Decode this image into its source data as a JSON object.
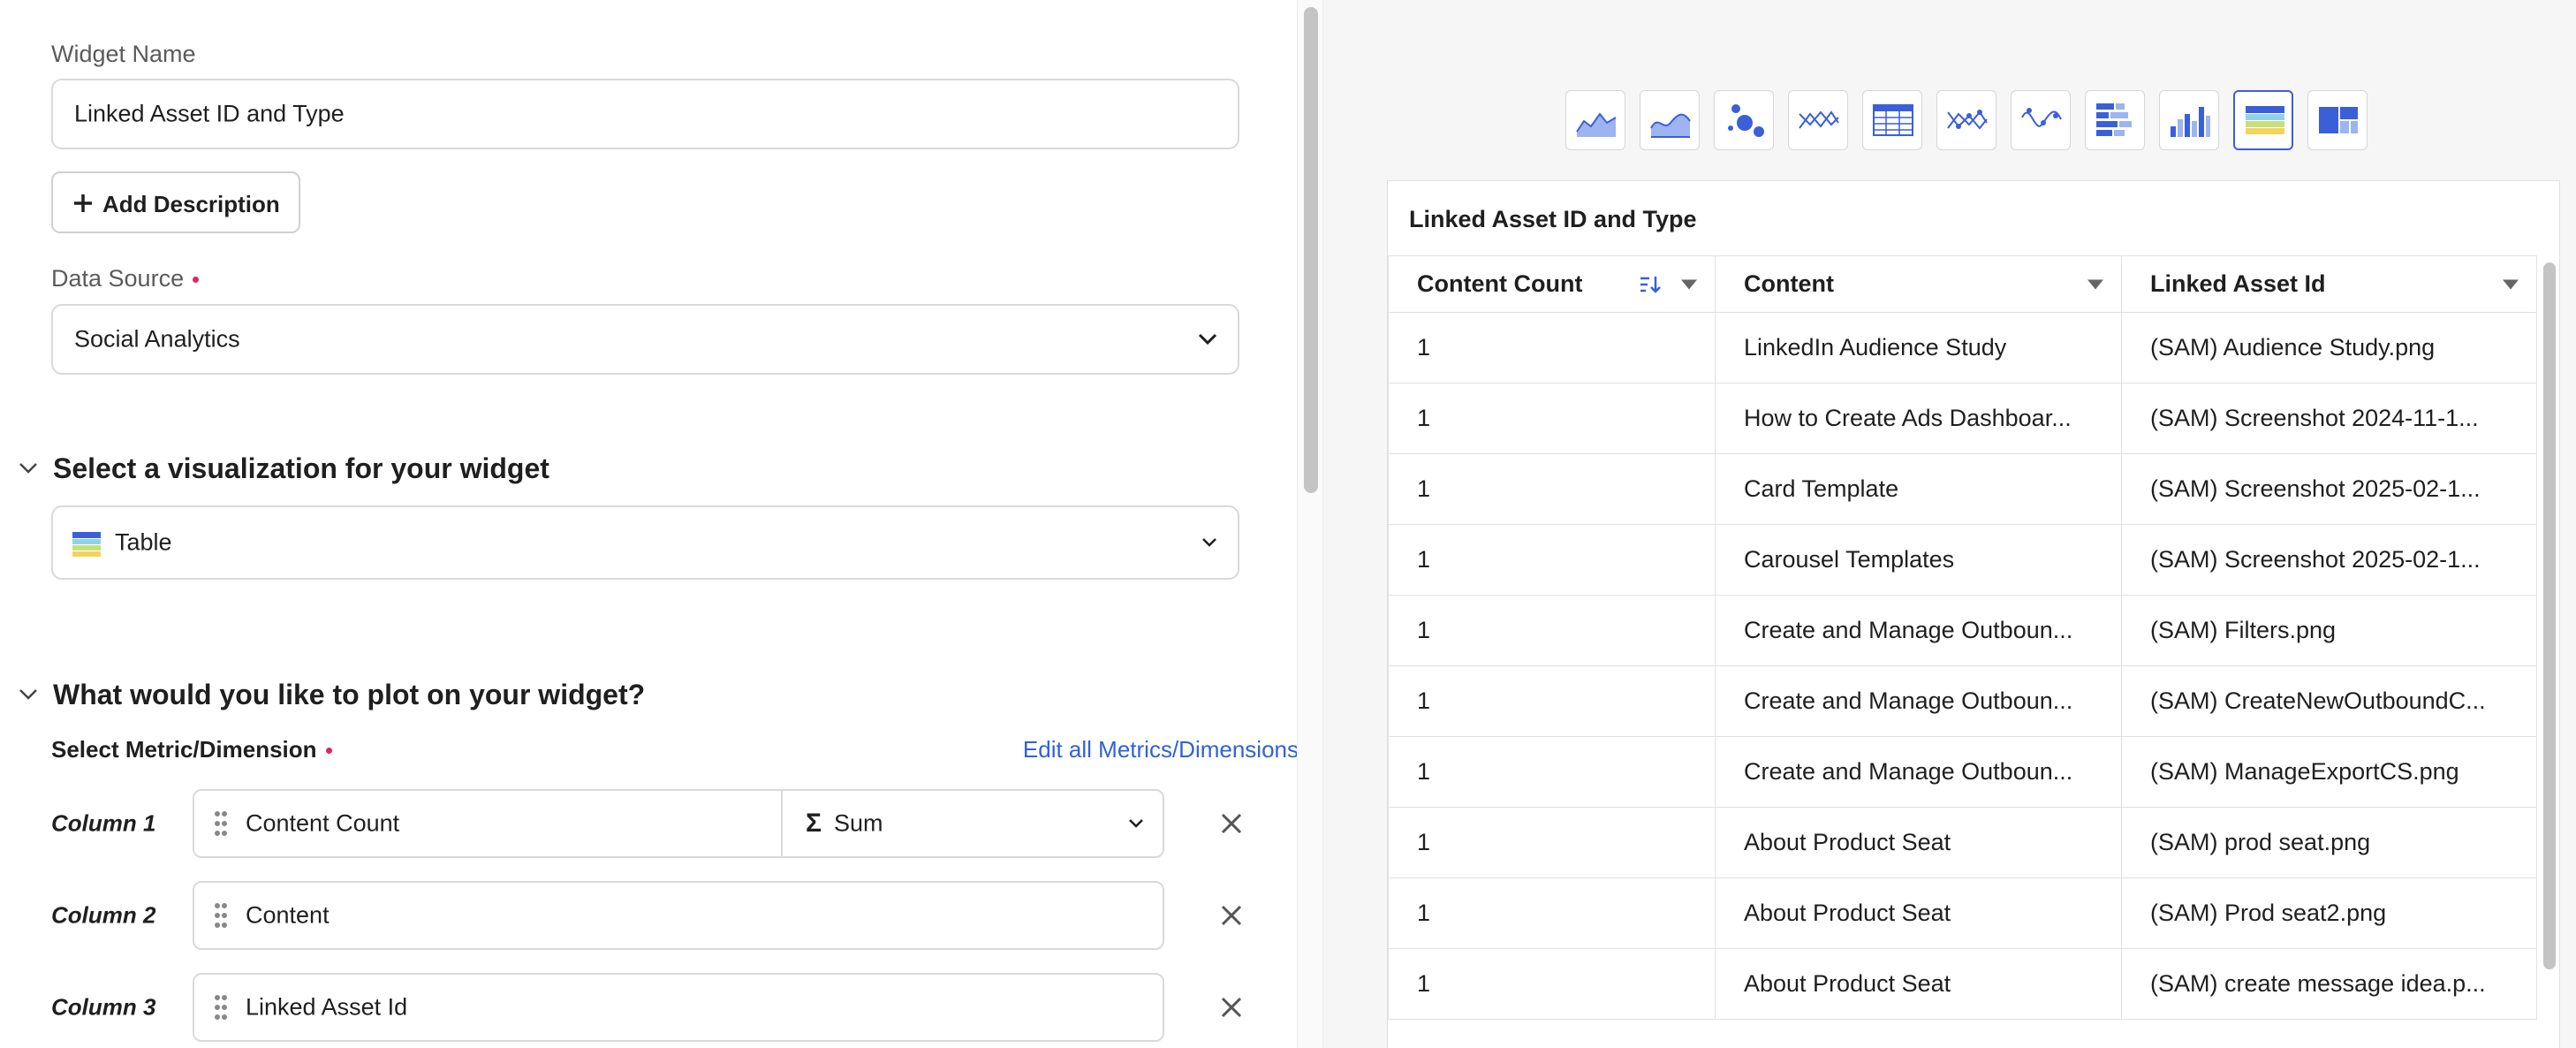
{
  "widget": {
    "name_label": "Widget Name",
    "name_value": "Linked Asset ID and Type",
    "add_description_label": "Add Description",
    "data_source_label": "Data Source",
    "data_source_value": "Social Analytics"
  },
  "visualization": {
    "section_title": "Select a visualization for your widget",
    "selected": "Table"
  },
  "plot": {
    "section_title": "What would you like to plot on your widget?",
    "metric_label": "Select Metric/Dimension",
    "edit_link": "Edit all Metrics/Dimensions",
    "columns": [
      {
        "label": "Column 1",
        "value": "Content Count",
        "aggregation": "Sum"
      },
      {
        "label": "Column 2",
        "value": "Content"
      },
      {
        "label": "Column 3",
        "value": "Linked Asset Id"
      }
    ]
  },
  "preview": {
    "viz_icons": [
      "area-chart-icon",
      "spline-area-icon",
      "bubble-chart-icon",
      "line-chart-icon",
      "pivot-table-icon",
      "scatter-line-icon",
      "spline-chart-icon",
      "stacked-bar-icon",
      "column-chart-icon",
      "table-icon",
      "treemap-icon"
    ],
    "active_viz": "table-icon",
    "card_title": "Linked Asset ID and Type",
    "headers": [
      "Content Count",
      "Content",
      "Linked Asset Id"
    ],
    "rows": [
      [
        "1",
        "LinkedIn Audience Study",
        "(SAM) Audience Study.png"
      ],
      [
        "1",
        "How to Create Ads Dashboar...",
        "(SAM) Screenshot 2024-11-1..."
      ],
      [
        "1",
        "Card Template",
        "(SAM) Screenshot 2025-02-1..."
      ],
      [
        "1",
        "Carousel Templates",
        "(SAM) Screenshot 2025-02-1..."
      ],
      [
        "1",
        "Create and Manage Outboun...",
        "(SAM) Filters.png"
      ],
      [
        "1",
        "Create and Manage Outboun...",
        "(SAM) CreateNewOutboundC..."
      ],
      [
        "1",
        "Create and Manage Outboun...",
        "(SAM) ManageExportCS.png"
      ],
      [
        "1",
        "About Product Seat",
        "(SAM) prod seat.png"
      ],
      [
        "1",
        "About Product Seat",
        "(SAM) Prod seat2.png"
      ],
      [
        "1",
        "About Product Seat",
        "(SAM) create message idea.p..."
      ]
    ]
  },
  "colors": {
    "accent": "#3a5fd8",
    "link": "#2f62d8",
    "required": "#e0245e",
    "border": "#d9d9d9"
  }
}
